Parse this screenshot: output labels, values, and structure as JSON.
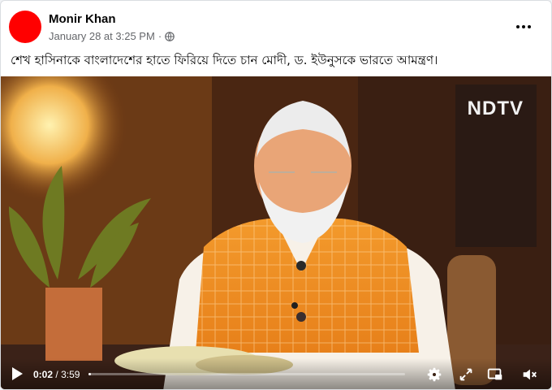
{
  "post": {
    "author": "Monir Khan",
    "timestamp": "January 28 at 3:25 PM",
    "separator": "·",
    "audience_icon": "globe-icon",
    "more_icon": "more-options-icon",
    "caption": "শেখ হাসিনাকে বাংলাদেশের হাতে ফিরিয়ে দিতে চান মোদী, ড. ইউনুসকে ভারতে আমন্ত্রণ।",
    "avatar_color": "#ff0000"
  },
  "video": {
    "watermark": "NDTV",
    "current_time": "0:02",
    "time_separator": "/",
    "duration": "3:59",
    "progress_fraction": 0.008,
    "icons": [
      "play-icon",
      "settings-icon",
      "fullscreen-icon",
      "picture-in-picture-icon",
      "volume-muted-icon"
    ]
  }
}
